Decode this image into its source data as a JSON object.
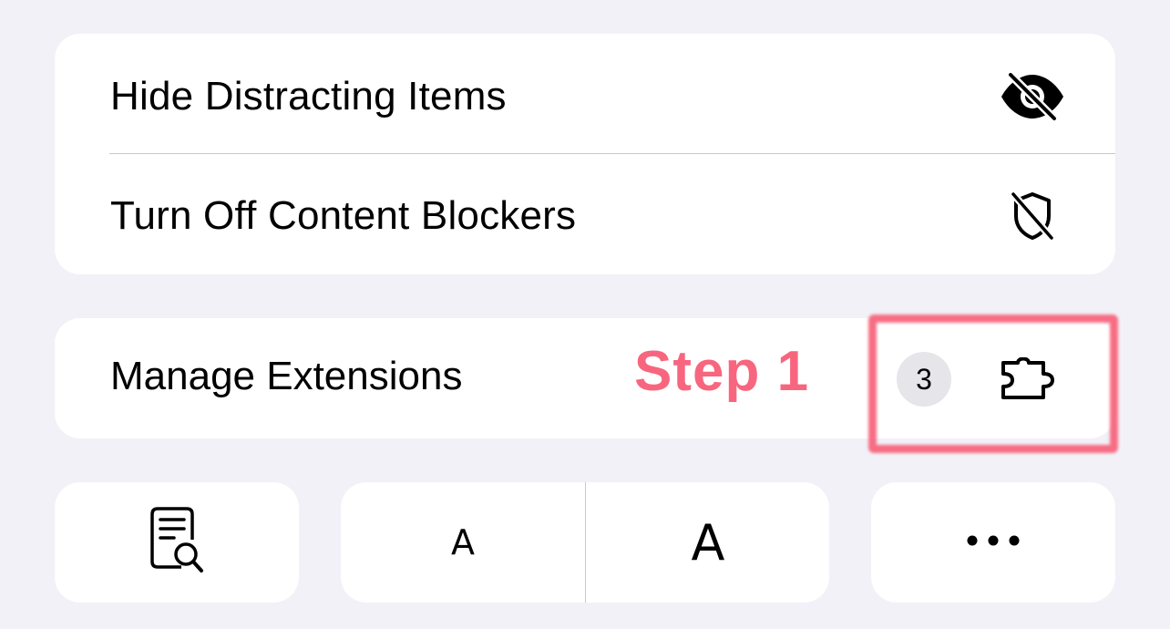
{
  "menu": {
    "hide_distracting": {
      "label": "Hide Distracting Items",
      "icon": "eye-slash-icon"
    },
    "content_blockers": {
      "label": "Turn Off Content Blockers",
      "icon": "shield-slash-icon"
    }
  },
  "extensions": {
    "label": "Manage Extensions",
    "badge_count": "3",
    "icon": "puzzle-piece-icon"
  },
  "annotation": {
    "step_text": "Step 1",
    "color": "#f7667e"
  },
  "toolbar": {
    "reader_icon": "page-search-icon",
    "font_smaller": "A",
    "font_larger": "A",
    "more_icon": "ellipsis-icon"
  },
  "colors": {
    "background": "#f1f1f7",
    "card": "#ffffff",
    "badge": "#e5e5ea"
  }
}
